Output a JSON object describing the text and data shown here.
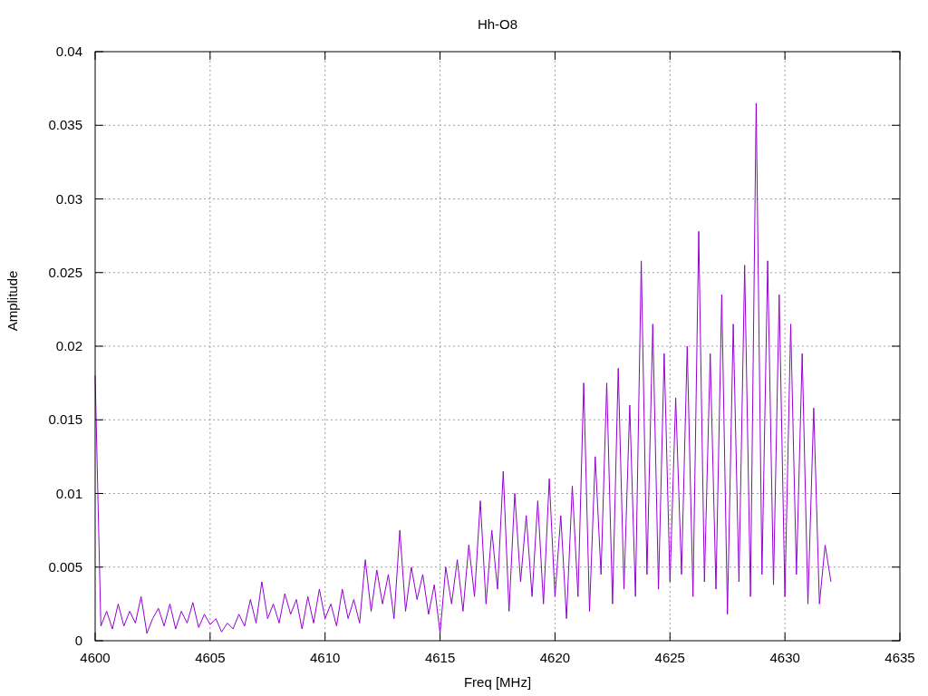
{
  "chart_data": {
    "type": "line",
    "grid": true,
    "title": "Hh-O8",
    "xlabel": "Freq [MHz]",
    "ylabel": "Amplitude",
    "xlim": [
      4600,
      4635
    ],
    "ylim": [
      0,
      0.04
    ],
    "xticks": [
      4600,
      4605,
      4610,
      4615,
      4620,
      4625,
      4630,
      4635
    ],
    "yticks": [
      0,
      0.005,
      0.01,
      0.015,
      0.02,
      0.025,
      0.03,
      0.035,
      0.04
    ],
    "x": [
      4600,
      4600.25,
      4600.5,
      4600.75,
      4601,
      4601.25,
      4601.5,
      4601.75,
      4602,
      4602.25,
      4602.5,
      4602.75,
      4603,
      4603.25,
      4603.5,
      4603.75,
      4604,
      4604.25,
      4604.5,
      4604.75,
      4605,
      4605.25,
      4605.5,
      4605.75,
      4606,
      4606.25,
      4606.5,
      4606.75,
      4607,
      4607.25,
      4607.5,
      4607.75,
      4608,
      4608.25,
      4608.5,
      4608.75,
      4609,
      4609.25,
      4609.5,
      4609.75,
      4610,
      4610.25,
      4610.5,
      4610.75,
      4611,
      4611.25,
      4611.5,
      4611.75,
      4612,
      4612.25,
      4612.5,
      4612.75,
      4613,
      4613.25,
      4613.5,
      4613.75,
      4614,
      4614.25,
      4614.5,
      4614.75,
      4615,
      4615.25,
      4615.5,
      4615.75,
      4616,
      4616.25,
      4616.5,
      4616.75,
      4617,
      4617.25,
      4617.5,
      4617.75,
      4618,
      4618.25,
      4618.5,
      4618.75,
      4619,
      4619.25,
      4619.5,
      4619.75,
      4620,
      4620.25,
      4620.5,
      4620.75,
      4621,
      4621.25,
      4621.5,
      4621.75,
      4622,
      4622.25,
      4622.5,
      4622.75,
      4623,
      4623.25,
      4623.5,
      4623.75,
      4624,
      4624.25,
      4624.5,
      4624.75,
      4625,
      4625.25,
      4625.5,
      4625.75,
      4626,
      4626.25,
      4626.5,
      4626.75,
      4627,
      4627.25,
      4627.5,
      4627.75,
      4628,
      4628.25,
      4628.5,
      4628.75,
      4629,
      4629.25,
      4629.5,
      4629.75,
      4630,
      4630.25,
      4630.5,
      4630.75,
      4631,
      4631.25,
      4631.5,
      4631.75,
      4632
    ],
    "series": [
      {
        "color": "#9400d3",
        "values": [
          0.018,
          0.001,
          0.002,
          0.0008,
          0.0025,
          0.001,
          0.002,
          0.0012,
          0.003,
          0.0005,
          0.0015,
          0.0022,
          0.001,
          0.0025,
          0.0008,
          0.002,
          0.0012,
          0.0026,
          0.0009,
          0.0018,
          0.0011,
          0.0015,
          0.0006,
          0.0012,
          0.0008,
          0.0018,
          0.001,
          0.0028,
          0.0012,
          0.004,
          0.0015,
          0.0025,
          0.0012,
          0.0032,
          0.0018,
          0.0028,
          0.0008,
          0.003,
          0.0012,
          0.0035,
          0.0015,
          0.0025,
          0.001,
          0.0035,
          0.0015,
          0.0028,
          0.0012,
          0.0055,
          0.002,
          0.0048,
          0.0025,
          0.0045,
          0.0015,
          0.0075,
          0.002,
          0.005,
          0.0028,
          0.0045,
          0.0018,
          0.0038,
          0.0005,
          0.005,
          0.0025,
          0.0055,
          0.002,
          0.0065,
          0.003,
          0.0095,
          0.0025,
          0.0075,
          0.0035,
          0.0115,
          0.002,
          0.01,
          0.004,
          0.0085,
          0.003,
          0.0095,
          0.0025,
          0.011,
          0.003,
          0.0085,
          0.0015,
          0.0105,
          0.003,
          0.0175,
          0.002,
          0.0125,
          0.0045,
          0.0175,
          0.0025,
          0.0185,
          0.0035,
          0.016,
          0.003,
          0.0258,
          0.0045,
          0.0215,
          0.0035,
          0.0195,
          0.004,
          0.0165,
          0.0045,
          0.02,
          0.003,
          0.0278,
          0.004,
          0.0195,
          0.0035,
          0.0235,
          0.0018,
          0.0215,
          0.004,
          0.0255,
          0.003,
          0.0365,
          0.0045,
          0.0258,
          0.0038,
          0.0235,
          0.003,
          0.0215,
          0.0045,
          0.0195,
          0.0025,
          0.0158,
          0.0025,
          0.0065,
          0.004
        ]
      }
    ]
  }
}
